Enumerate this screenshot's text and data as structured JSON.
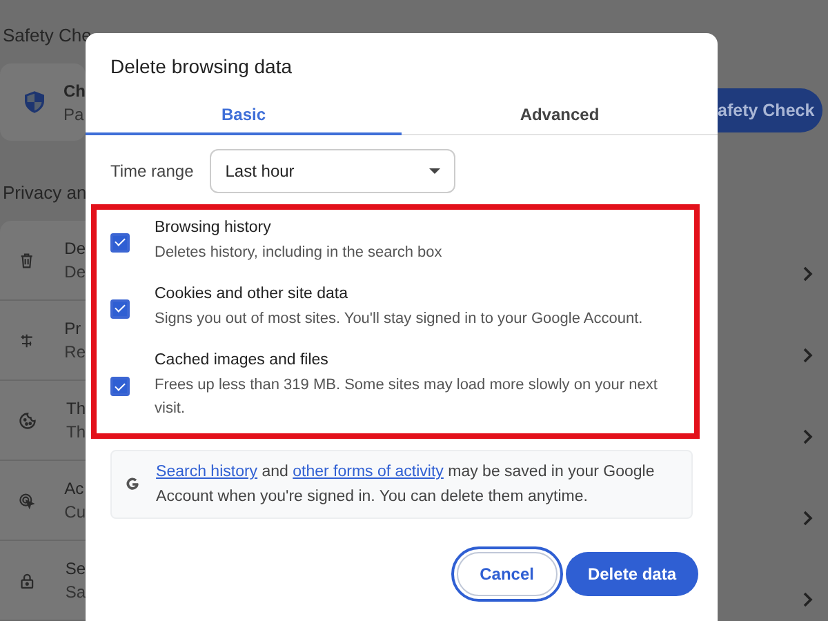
{
  "background": {
    "section_title": "Safety Che",
    "safety_card": {
      "title": "Ch",
      "subtitle": "Pa",
      "button": "afety Check"
    },
    "privacy_title": "Privacy an",
    "privacy_rows": [
      {
        "kind": "trash",
        "title": "De",
        "subtitle": "De"
      },
      {
        "kind": "sliders",
        "title": "Pr",
        "subtitle": "Re"
      },
      {
        "kind": "cookie",
        "title": "Th",
        "subtitle": "Th"
      },
      {
        "kind": "cursor",
        "title": "Ac",
        "subtitle": "Cu"
      },
      {
        "kind": "lock",
        "title": "Se",
        "subtitle": "Sa"
      }
    ]
  },
  "dialog": {
    "title": "Delete browsing data",
    "tabs": [
      {
        "label": "Basic",
        "selected": true
      },
      {
        "label": "Advanced",
        "selected": false
      }
    ],
    "time_range": {
      "label": "Time range",
      "value": "Last hour"
    },
    "options": [
      {
        "title": "Browsing history",
        "description": "Deletes history, including in the search box",
        "checked": true
      },
      {
        "title": "Cookies and other site data",
        "description": "Signs you out of most sites. You'll stay signed in to your Google Account.",
        "checked": true
      },
      {
        "title": "Cached images and files",
        "description": "Frees up less than 319 MB. Some sites may load more slowly on your next visit.",
        "checked": true
      }
    ],
    "info": [
      {
        "kind": "link",
        "text": "Search history"
      },
      {
        "kind": "text",
        "text": " and "
      },
      {
        "kind": "link",
        "text": "other forms of activity"
      },
      {
        "kind": "text",
        "text": " may be saved in your Google Account when you're signed in. You can delete them anytime."
      }
    ],
    "buttons": [
      {
        "kind": "secondary",
        "label": "Cancel",
        "focused": true
      },
      {
        "kind": "primary",
        "label": "Delete data",
        "focused": false
      }
    ]
  }
}
